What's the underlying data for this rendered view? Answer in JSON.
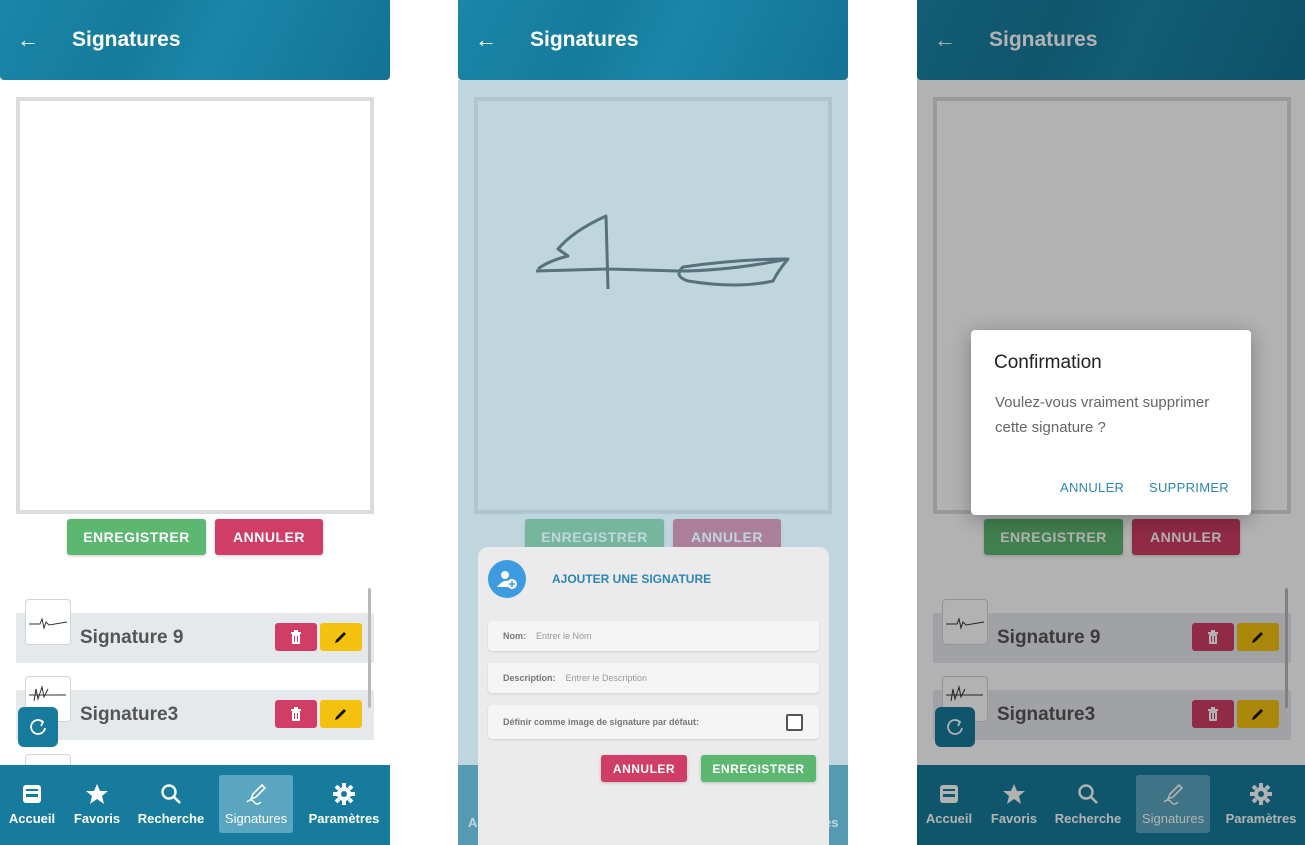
{
  "header": {
    "title": "Signatures"
  },
  "actions": {
    "save": "ENREGISTRER",
    "cancel": "ANNULER"
  },
  "signatures": [
    {
      "name": "Signature 9"
    },
    {
      "name": "Signature3"
    }
  ],
  "nav": [
    {
      "label": "Accueil",
      "icon": "inbox-icon"
    },
    {
      "label": "Favoris",
      "icon": "star-icon"
    },
    {
      "label": "Recherche",
      "icon": "search-icon"
    },
    {
      "label": "Signatures",
      "icon": "signature-pen-icon",
      "active": true
    },
    {
      "label": "Paramètres",
      "icon": "gear-icon"
    }
  ],
  "nav_partial": {
    "left": "Ac",
    "right": "es"
  },
  "sheet": {
    "title": "AJOUTER UNE SIGNATURE",
    "name_label": "Nom:",
    "name_placeholder": "Entrer le Nom",
    "desc_label": "Description:",
    "desc_placeholder": "Entrer le Description",
    "default_label": "Définir comme image de signature par défaut:",
    "default_checked": false,
    "cancel": "ANNULER",
    "save": "ENREGISTRER"
  },
  "dialog": {
    "title": "Confirmation",
    "message": "Voulez-vous vraiment supprimer cette signature ?",
    "cancel": "ANNULER",
    "confirm": "SUPPRIMER"
  },
  "colors": {
    "primary": "#167b9c",
    "save_green": "#5cb870",
    "cancel_red": "#d03d66",
    "edit_yellow": "#f4c10e",
    "link_blue": "#2d86b5"
  }
}
